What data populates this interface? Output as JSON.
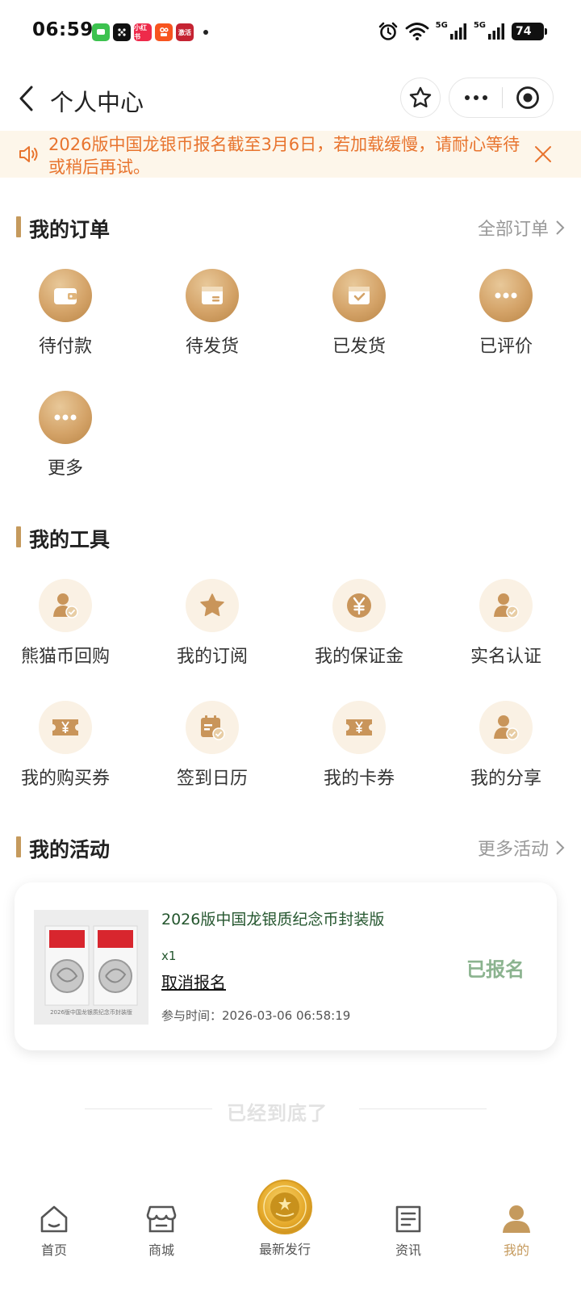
{
  "status": {
    "time": "06:59",
    "battery": "74",
    "signal_label": "5G",
    "app_icons": [
      {
        "name": "messages-app-icon",
        "color": "#3cc24f",
        "text": ""
      },
      {
        "name": "dice-app-icon",
        "color": "#111111",
        "text": ""
      },
      {
        "name": "xiaohongshu-app-icon",
        "color": "#ee2a4a",
        "text": "小红书"
      },
      {
        "name": "kuaishou-app-icon",
        "color": "#f7541f",
        "text": ""
      },
      {
        "name": "news-app-icon",
        "color": "#c52332",
        "text": "激活"
      }
    ]
  },
  "nav": {
    "title": "个人中心"
  },
  "notice": {
    "text": "2026版中国龙银币报名截至3月6日，若加载缓慢，请耐心等待或稍后再试。"
  },
  "orders": {
    "title": "我的订单",
    "link": "全部订单",
    "items": [
      {
        "label": "待付款",
        "icon": "wallet-icon"
      },
      {
        "label": "待发货",
        "icon": "package-icon"
      },
      {
        "label": "已发货",
        "icon": "shipped-box-icon"
      },
      {
        "label": "已评价",
        "icon": "comment-dots-icon"
      },
      {
        "label": "更多",
        "icon": "more-dots-icon"
      }
    ]
  },
  "tools": {
    "title": "我的工具",
    "items": [
      {
        "label": "熊猫币回购",
        "icon": "user-check-icon"
      },
      {
        "label": "我的订阅",
        "icon": "star-icon"
      },
      {
        "label": "我的保证金",
        "icon": "yen-coin-icon"
      },
      {
        "label": "实名认证",
        "icon": "user-check-icon"
      },
      {
        "label": "我的购买券",
        "icon": "yen-ticket-icon"
      },
      {
        "label": "签到日历",
        "icon": "calendar-check-icon"
      },
      {
        "label": "我的卡券",
        "icon": "yen-ticket-icon"
      },
      {
        "label": "我的分享",
        "icon": "user-check-icon"
      }
    ]
  },
  "activities": {
    "title": "我的活动",
    "link": "更多活动",
    "card": {
      "title": "2026版中国龙银质纪念币封装版",
      "qty": "x1",
      "cancel": "取消报名",
      "time": "参与时间：2026-03-06 06:58:19",
      "status": "已报名",
      "image_caption": "2026版中国龙银质纪念币封装版"
    }
  },
  "end_text": "已经到底了",
  "tabs": [
    {
      "label": "首页",
      "icon": "home-icon",
      "active": false
    },
    {
      "label": "商城",
      "icon": "shop-icon",
      "active": false
    },
    {
      "label": "最新发行",
      "icon": "coin-emblem-icon",
      "active": false
    },
    {
      "label": "资讯",
      "icon": "news-icon",
      "active": false
    },
    {
      "label": "我的",
      "icon": "profile-icon",
      "active": true
    }
  ],
  "colors": {
    "accent_gold": "#c59a5d",
    "notice_text": "#e8742e",
    "notice_bg": "#fdf6ea",
    "card_green": "#24562e",
    "status_green": "#8bb38f"
  }
}
